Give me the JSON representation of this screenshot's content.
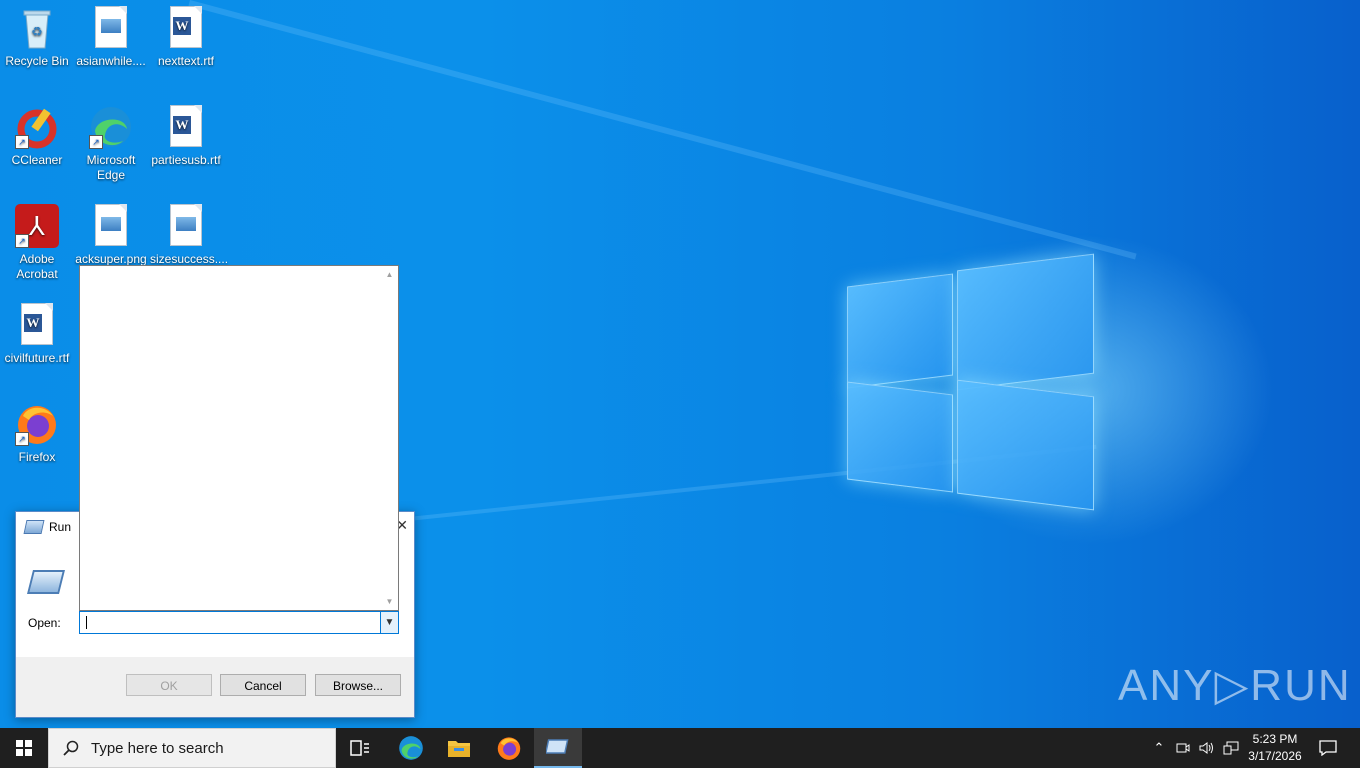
{
  "desktop_icons": [
    {
      "label": "Recycle Bin",
      "icon": "recycle-bin-icon"
    },
    {
      "label": "asianwhile....",
      "icon": "image-file-icon"
    },
    {
      "label": "nexttext.rtf",
      "icon": "word-document-icon"
    },
    {
      "label": "CCleaner",
      "icon": "ccleaner-icon"
    },
    {
      "label": "Microsoft Edge",
      "icon": "edge-icon"
    },
    {
      "label": "partiesusb.rtf",
      "icon": "word-document-icon"
    },
    {
      "label": "Adobe Acrobat",
      "icon": "acrobat-icon"
    },
    {
      "label": "acksuper.png",
      "icon": "image-file-icon"
    },
    {
      "label": "sizesuccess....",
      "icon": "image-file-icon"
    },
    {
      "label": "civilfuture.rtf",
      "icon": "word-document-icon"
    },
    {
      "label": "Firefox",
      "icon": "firefox-icon"
    }
  ],
  "run_dialog": {
    "title": "Run",
    "close_glyph": "✕",
    "open_label": "Open:",
    "input_value": "",
    "ok_label": "OK",
    "ok_enabled": false,
    "cancel_label": "Cancel",
    "browse_label": "Browse..."
  },
  "taskbar": {
    "search_placeholder": "Type here to search",
    "pinned": [
      "task-view-icon",
      "edge-icon",
      "file-explorer-icon",
      "firefox-icon",
      "run-icon"
    ],
    "active_app": "run-icon",
    "time": "5:23 PM",
    "date": "3/17/2026"
  },
  "watermark": "ANY▷RUN",
  "colors": {
    "accent": "#0078d7",
    "taskbar": "#1f1f1f",
    "wallpaper": "#0a7fe0"
  }
}
